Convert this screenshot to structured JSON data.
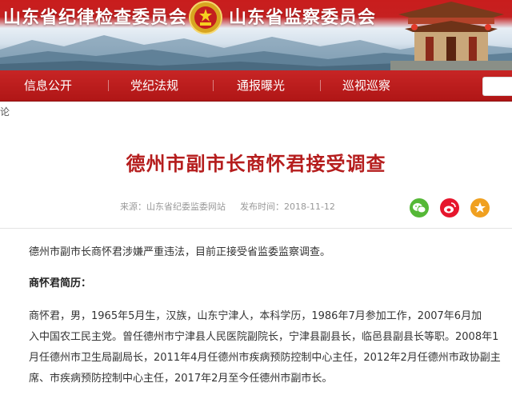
{
  "header": {
    "title_left": "山东省纪律检查委员会",
    "title_right": "山东省监察委员会",
    "emblem_icon": "national-emblem-icon",
    "building_icon": "pavilion-icon"
  },
  "nav": {
    "items": [
      {
        "label": "信息公开"
      },
      {
        "label": "党纪法规"
      },
      {
        "label": "通报曝光"
      },
      {
        "label": "巡视巡察"
      }
    ]
  },
  "breadcrumb": {
    "fragment": "论"
  },
  "article": {
    "title": "德州市副市长商怀君接受调查",
    "source": "来源：山东省纪委监委网站",
    "date": "发布时间：2018-11-12",
    "share": [
      "wechat-icon",
      "weibo-icon",
      "star-icon"
    ],
    "paragraph1": "德州市副市长商怀君涉嫌严重违法，目前正接受省监委监察调查。",
    "heading": "商怀君简历：",
    "bio_lines": [
      "商怀君，男，1965年5月生，汉族，山东宁津人，本科学历，1986年7月参加工作，2007年6月加",
      "入中国农工民主党。曾任德州市宁津县人民医院副院长，宁津县副县长，临邑县副县长等职。2008年1",
      "月任德州市卫生局副局长，2011年4月任德州市疾病预防控制中心主任，2012年2月任德州市政协副主",
      "席、市疾病预防控制中心主任，2017年2月至今任德州市副市长。"
    ]
  },
  "colors": {
    "brand_red": "#c62020",
    "title_red": "#b51d1d"
  }
}
